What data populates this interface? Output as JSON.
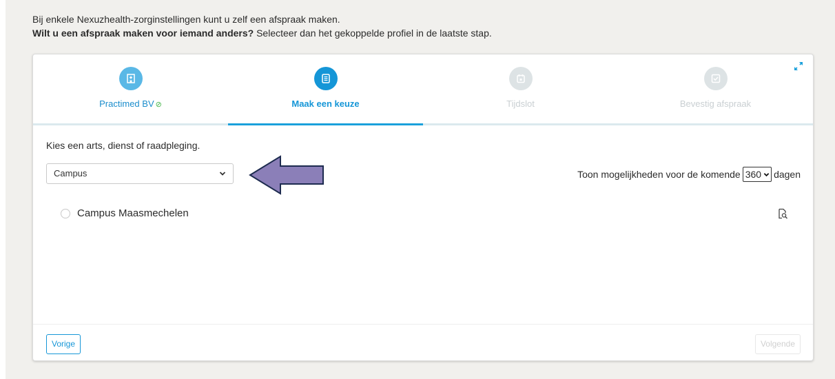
{
  "intro": {
    "line1": "Bij enkele Nexuzhealth-zorginstellingen kunt u zelf een afspraak maken.",
    "line2_bold": "Wilt u een afspraak maken voor iemand anders?",
    "line2_rest": " Selecteer dan het gekoppelde profiel in de laatste stap."
  },
  "steps": [
    {
      "label": "Practimed BV",
      "state": "done",
      "icon": "hospital-icon"
    },
    {
      "label": "Maak een keuze",
      "state": "active",
      "icon": "list-icon"
    },
    {
      "label": "Tijdslot",
      "state": "todo",
      "icon": "calendar-icon"
    },
    {
      "label": "Bevestig afspraak",
      "state": "todo",
      "icon": "check-square-icon"
    }
  ],
  "choice": {
    "instruction": "Kies een arts, dienst of raadpleging.",
    "select_value": "Campus"
  },
  "days": {
    "prefix": "Toon mogelijkheden voor de komende",
    "value": "360",
    "suffix": "dagen"
  },
  "options": [
    {
      "label": "Campus Maasmechelen",
      "selected": false
    }
  ],
  "footer": {
    "prev_label": "Vorige",
    "next_label": "Volgende"
  },
  "colors": {
    "accent": "#1596d7",
    "done": "#5ab8e6",
    "todo": "#dde3e5",
    "check": "#43b549",
    "arrow_fill": "#8b7fb8",
    "arrow_stroke": "#1d2b4f"
  }
}
